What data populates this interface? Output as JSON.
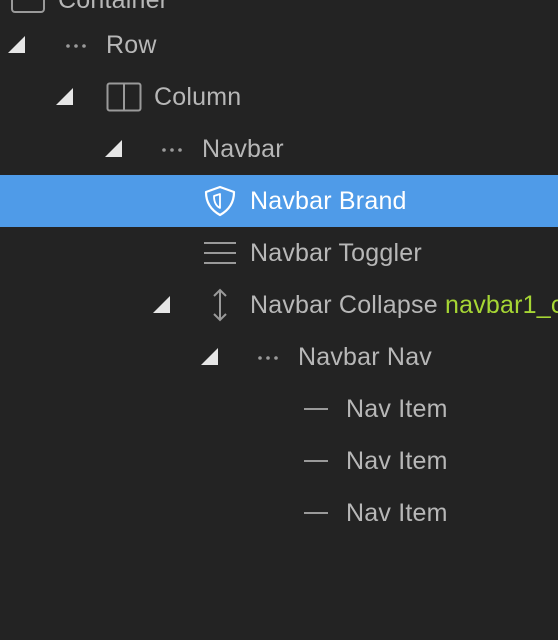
{
  "tree": {
    "container_label": "Container",
    "row_label": "Row",
    "column_label": "Column",
    "navbar_label": "Navbar",
    "navbar_brand_label": "Navbar Brand",
    "navbar_toggler_label": "Navbar Toggler",
    "navbar_collapse_label": "Navbar Collapse",
    "navbar_collapse_id": "navbar1_c",
    "navbar_nav_label": "Navbar Nav",
    "nav_items": [
      {
        "label": "Nav Item"
      },
      {
        "label": "Nav Item"
      },
      {
        "label": "Nav Item"
      }
    ]
  },
  "colors": {
    "background": "#232323",
    "selected_background": "#4f9be8",
    "text": "#b7b7b7",
    "id_tag": "#a6d634"
  },
  "icons": {
    "container": "container-icon",
    "row": "dots-icon",
    "column": "column-layout-icon",
    "navbar": "dots-icon",
    "navbar_brand": "shield-icon",
    "navbar_toggler": "hamburger-icon",
    "navbar_collapse": "vertical-resize-icon",
    "navbar_nav": "dots-icon",
    "nav_item": "dash-icon"
  }
}
